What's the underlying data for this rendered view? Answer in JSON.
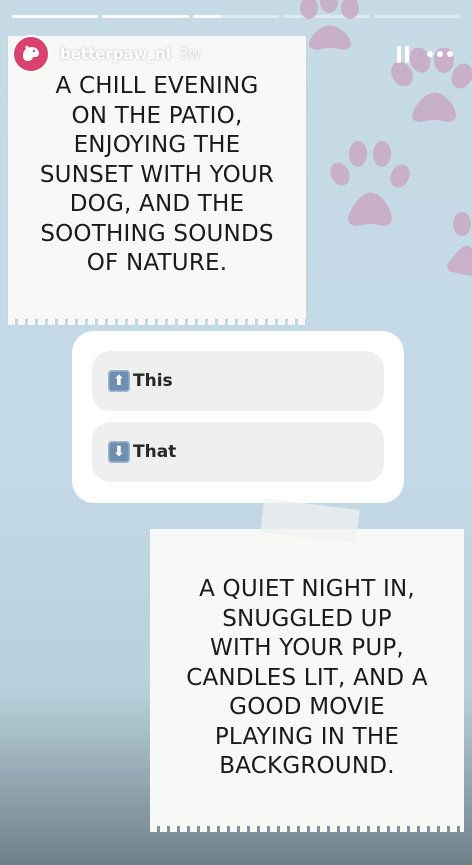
{
  "story": {
    "username": "betterpaw_nl",
    "time_ago": "3w",
    "progress": [
      1,
      1,
      0.33,
      0,
      0
    ]
  },
  "icons": {
    "avatar": "dog-logo-icon",
    "pause": "pause-icon",
    "more": "more-options-icon",
    "paw": "paw-print-icon",
    "up": "up-arrow-emoji-icon",
    "down": "down-arrow-emoji-icon"
  },
  "colors": {
    "background": "#c3d9e6",
    "avatar_bg": "#d9416f",
    "paw": "#c9a9c4",
    "card": "#f8f8f6",
    "poll_option": "#efefef",
    "emoji_key": "#6e8fb0"
  },
  "card_top": {
    "lines": [
      "A CHILL EVENING",
      "ON THE PATIO,",
      "ENJOYING THE",
      "SUNSET WITH YOUR",
      "DOG, AND THE",
      "SOOTHING SOUNDS",
      "OF NATURE."
    ]
  },
  "poll": {
    "options": [
      {
        "label": "This",
        "emoji": "⬆"
      },
      {
        "label": "That",
        "emoji": "⬇"
      }
    ]
  },
  "card_bottom": {
    "lines": [
      "A QUIET NIGHT IN,",
      "SNUGGLED UP",
      "WITH YOUR PUP,",
      "CANDLES LIT, AND A",
      "GOOD MOVIE",
      "PLAYING IN THE",
      "BACKGROUND."
    ]
  }
}
